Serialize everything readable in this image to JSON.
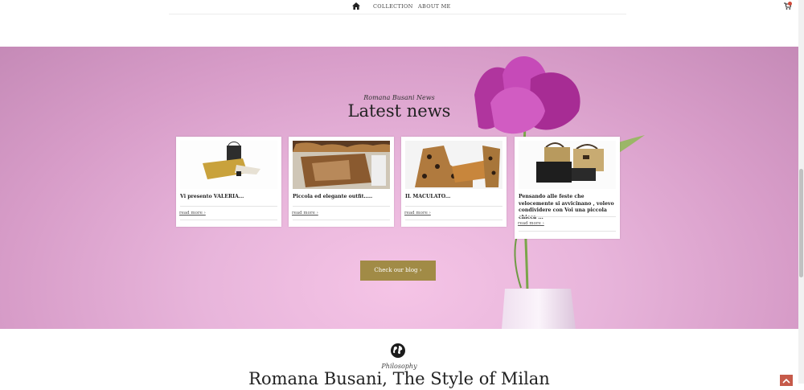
{
  "nav": {
    "home_icon": "home-icon",
    "items": [
      "COLLECTION",
      "ABOUT ME"
    ],
    "cart_icon": "cart-icon"
  },
  "news": {
    "eyebrow": "Romana Busani News",
    "heading": "Latest news",
    "cards": [
      {
        "title": "Vi presento VALERIA...",
        "more": "read more ›"
      },
      {
        "title": "Piccola ed elegante outfit.....",
        "more": "read more ›"
      },
      {
        "title": "IL MACULATO...",
        "more": "read more ›"
      },
      {
        "title": "Pensando alle feste che velocemente si avvicinano , volevo condividere con Voi una piccola chicca ...",
        "more": "read more ›"
      }
    ],
    "button": "Check our blog  ›"
  },
  "philosophy": {
    "icon": "globe-icon",
    "eyebrow": "Philosophy",
    "heading": "Romana Busani, The Style of Milan"
  },
  "colors": {
    "accent": "#a18b46",
    "hero_pink": "#e8b5db",
    "to_top": "#c65a4a"
  }
}
